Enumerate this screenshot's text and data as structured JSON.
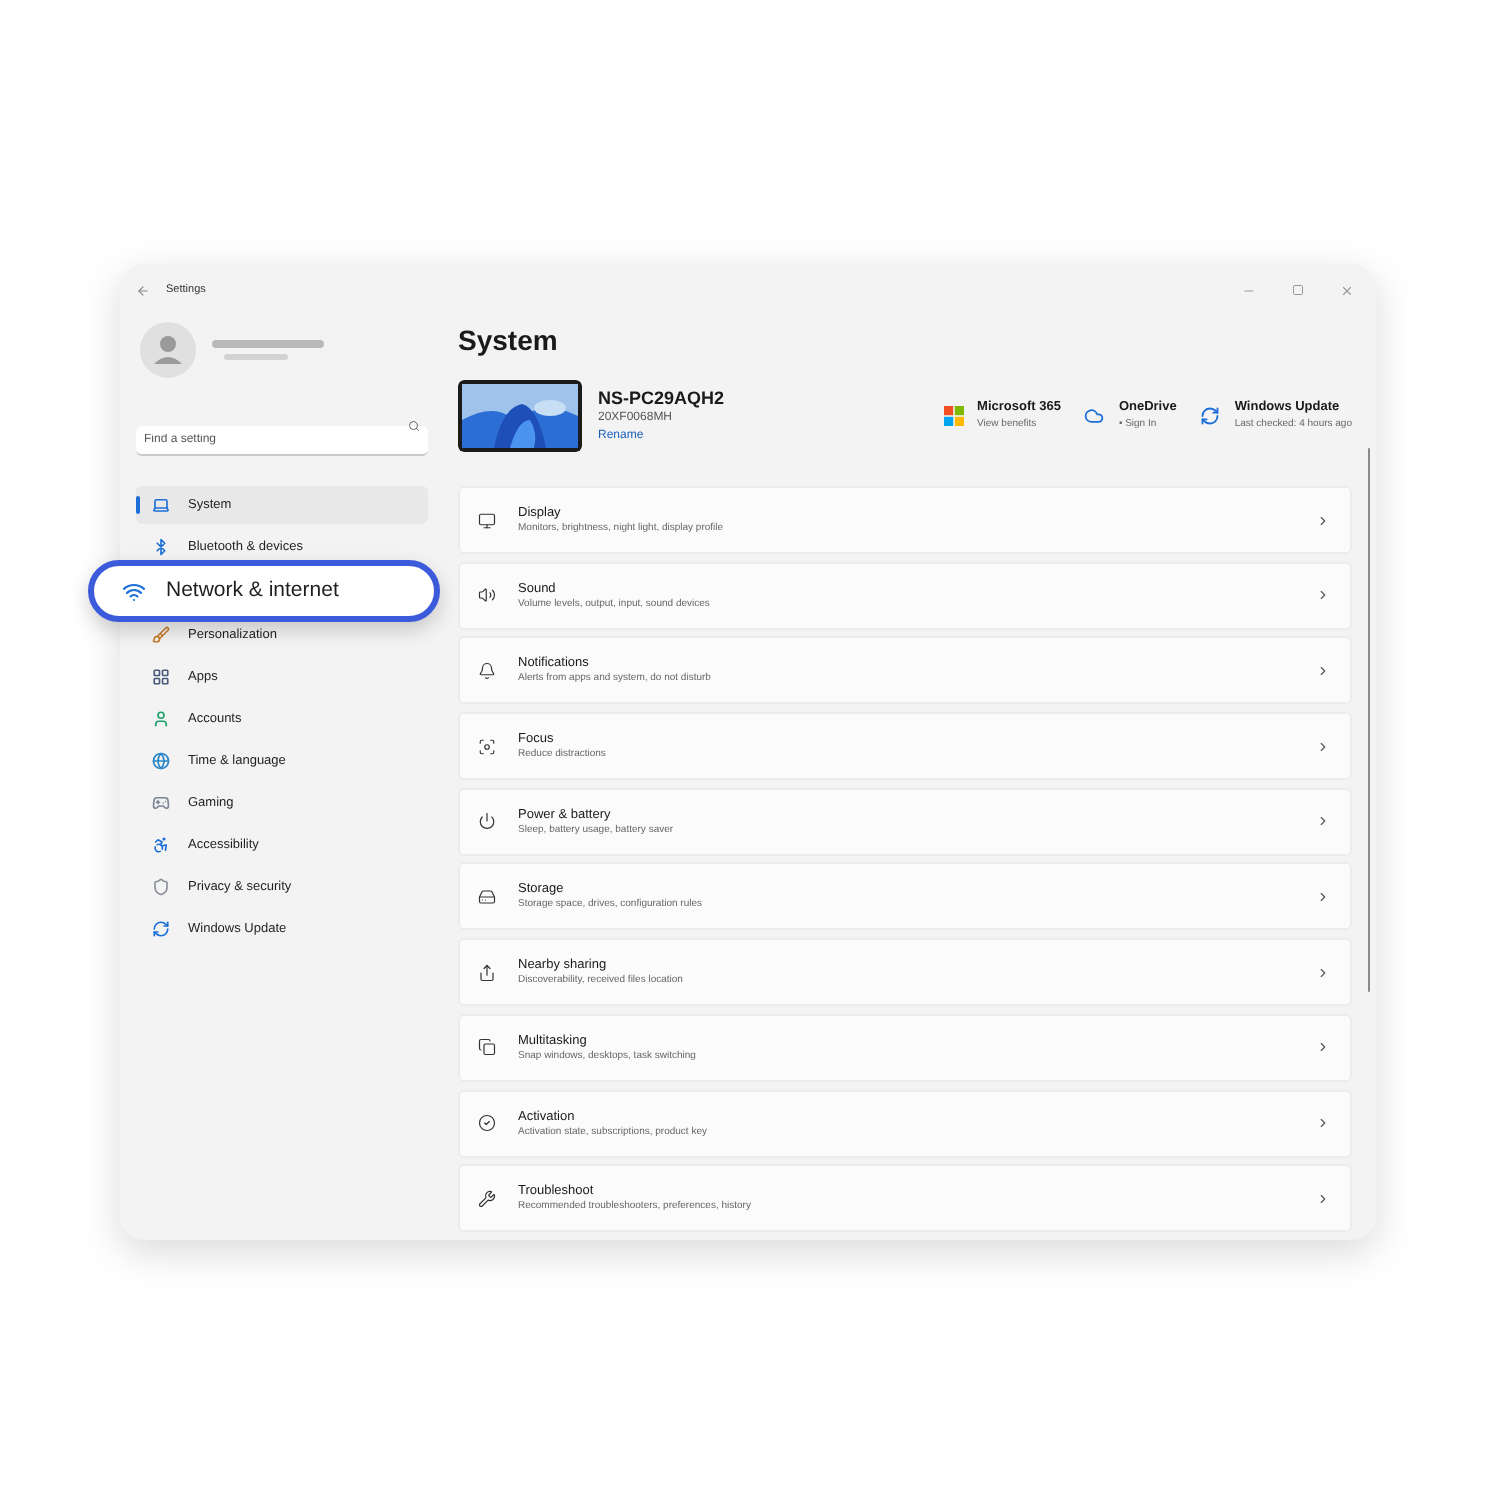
{
  "window": {
    "title": "Settings"
  },
  "sidebar": {
    "search": {
      "placeholder": "Find a setting"
    },
    "items": [
      {
        "label": "System",
        "selected": true,
        "highlighted": false
      },
      {
        "label": "Bluetooth & devices",
        "selected": false,
        "highlighted": false
      },
      {
        "label": "Network & internet",
        "selected": false,
        "highlighted": true
      },
      {
        "label": "Personalization",
        "selected": false,
        "highlighted": false
      },
      {
        "label": "Apps",
        "selected": false,
        "highlighted": false
      },
      {
        "label": "Accounts",
        "selected": false,
        "highlighted": false
      },
      {
        "label": "Time & language",
        "selected": false,
        "highlighted": false
      },
      {
        "label": "Gaming",
        "selected": false,
        "highlighted": false
      },
      {
        "label": "Accessibility",
        "selected": false,
        "highlighted": false
      },
      {
        "label": "Privacy & security",
        "selected": false,
        "highlighted": false
      },
      {
        "label": "Windows Update",
        "selected": false,
        "highlighted": false
      }
    ]
  },
  "page": {
    "title": "System",
    "device": {
      "name": "NS-PC29AQH2",
      "model": "20XF0068MH",
      "rename": "Rename"
    },
    "services": [
      {
        "title": "Microsoft 365",
        "subtitle": "View benefits"
      },
      {
        "title": "OneDrive",
        "subtitle": "• Sign In"
      },
      {
        "title": "Windows Update",
        "subtitle": "Last checked: 4 hours ago"
      }
    ],
    "cards": [
      {
        "title": "Display",
        "subtitle": "Monitors, brightness, night light, display profile"
      },
      {
        "title": "Sound",
        "subtitle": "Volume levels, output, input, sound devices"
      },
      {
        "title": "Notifications",
        "subtitle": "Alerts from apps and system, do not disturb"
      },
      {
        "title": "Focus",
        "subtitle": "Reduce distractions"
      },
      {
        "title": "Power & battery",
        "subtitle": "Sleep, battery usage, battery saver"
      },
      {
        "title": "Storage",
        "subtitle": "Storage space, drives, configuration rules"
      },
      {
        "title": "Nearby sharing",
        "subtitle": "Discoverability, received files location"
      },
      {
        "title": "Multitasking",
        "subtitle": "Snap windows, desktops, task switching"
      },
      {
        "title": "Activation",
        "subtitle": "Activation state, subscriptions, product key"
      },
      {
        "title": "Troubleshoot",
        "subtitle": "Recommended troubleshooters, preferences, history"
      }
    ]
  }
}
